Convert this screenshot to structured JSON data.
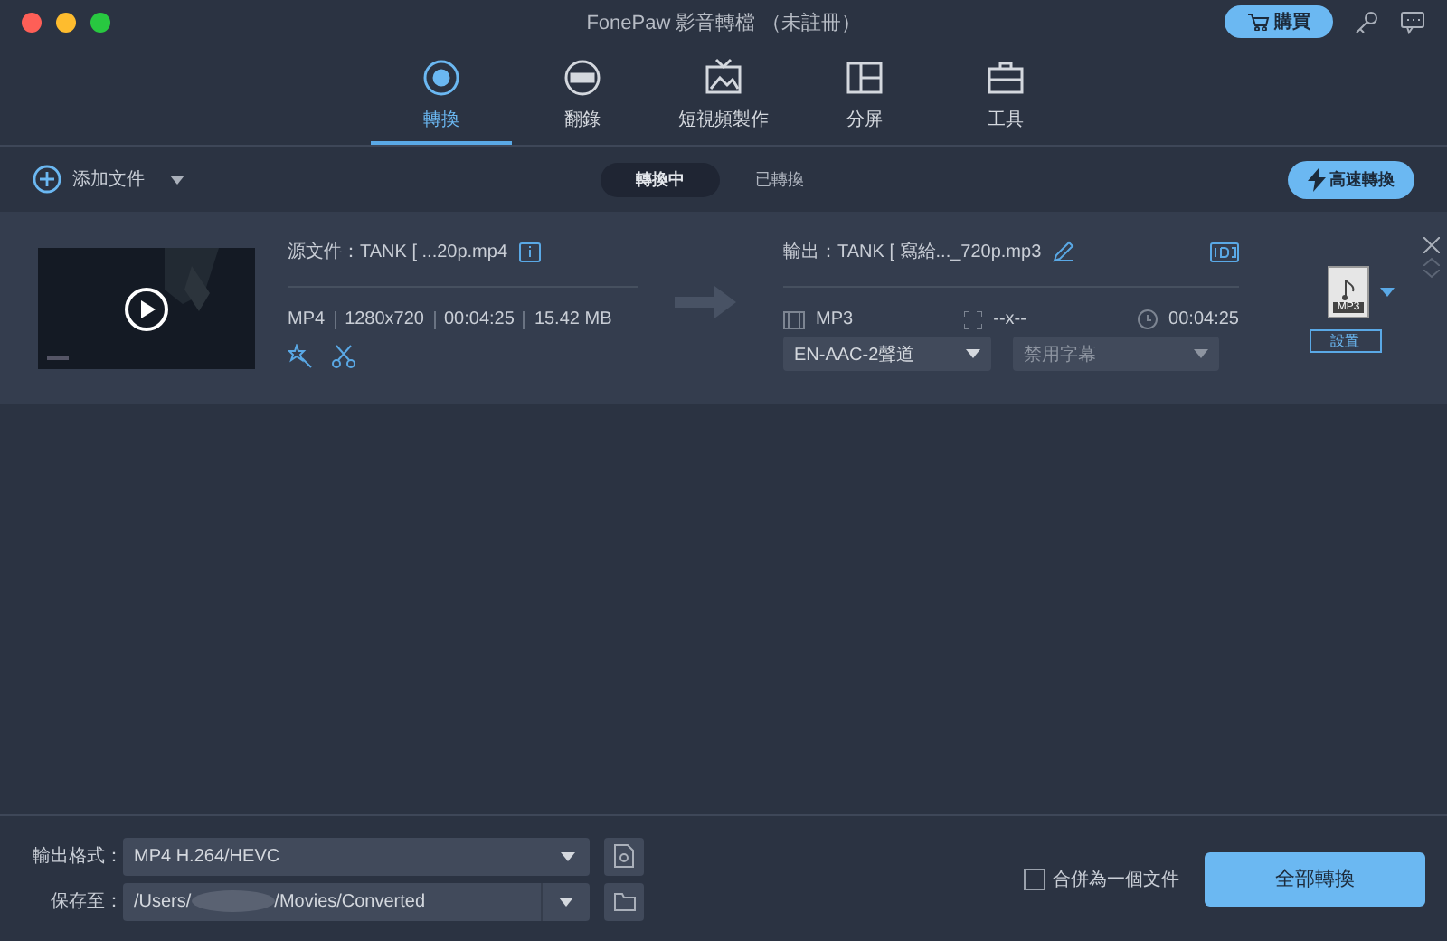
{
  "window": {
    "title": "FonePaw 影音轉檔 （未註冊）",
    "buy": "購買"
  },
  "tabs": [
    {
      "label": "轉換",
      "kind": "convert",
      "selected": true
    },
    {
      "label": "翻錄",
      "kind": "dvd",
      "selected": false
    },
    {
      "label": "短視頻製作",
      "kind": "tv",
      "selected": false
    },
    {
      "label": "分屏",
      "kind": "split",
      "selected": false
    },
    {
      "label": "工具",
      "kind": "toolbox",
      "selected": false
    }
  ],
  "toolbar": {
    "add": "添加文件",
    "views": [
      {
        "label": "轉換中",
        "selected": true
      },
      {
        "label": "已轉換",
        "selected": false
      }
    ],
    "fast": "高速轉換"
  },
  "file": {
    "source": "源文件：TANK [ ...20p.mp4",
    "format": "MP4",
    "resolution": "1280x720",
    "duration": "00:04:25",
    "size": "15.42 MB",
    "output": "輸出：TANK [ 寫給..._720p.mp3",
    "out_format": "MP3",
    "out_resolution": "--x--",
    "out_duration": "00:04:25",
    "audio": "EN-AAC-2聲道",
    "subtitle": "禁用字幕",
    "format_badge": "MP3",
    "settings": "設置"
  },
  "bottom": {
    "format_label": "輸出格式：",
    "format": "MP4 H.264/HEVC",
    "save_label": "保存至：",
    "path_start": "/Users/",
    "path_end": "/Movies/Converted",
    "merge": "合併為一個文件",
    "merge_checked": false,
    "convert_all": "全部轉換"
  }
}
